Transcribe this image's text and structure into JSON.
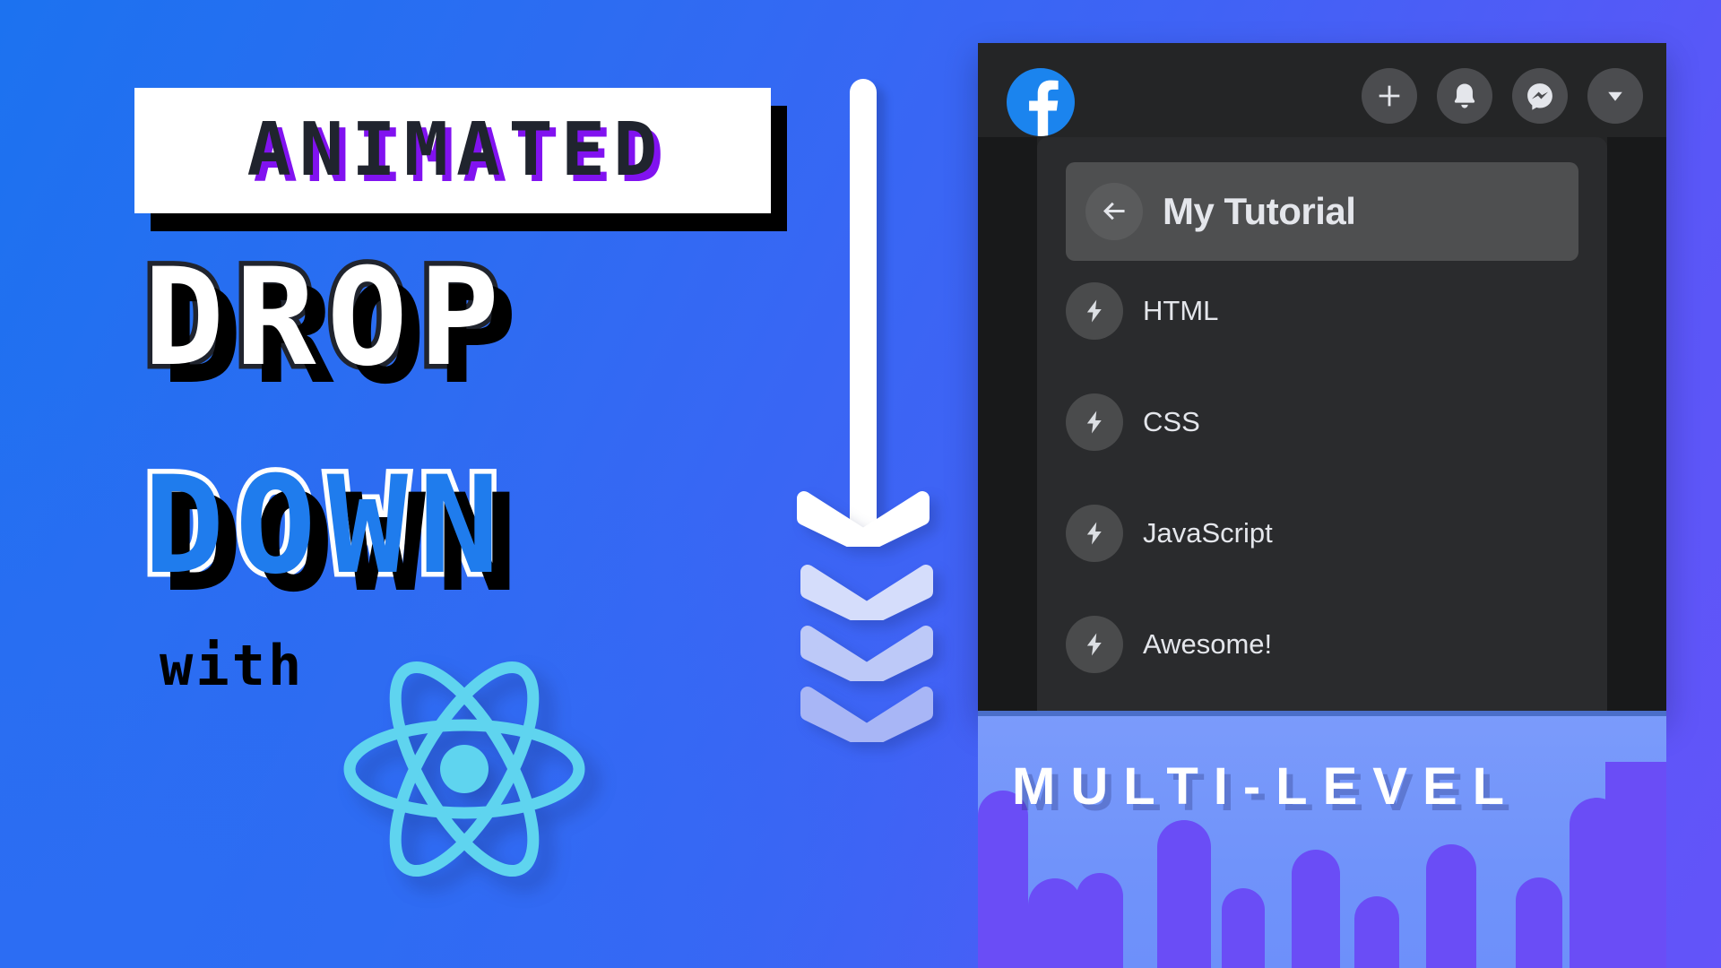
{
  "background": {
    "gradient_from": "#1c72f0",
    "gradient_to": "#6354f9"
  },
  "title_block": {
    "line1": "ANIMATED",
    "line2": "DROP",
    "line3": "DOWN",
    "line4": "with",
    "logo_name": "react-logo",
    "colors": {
      "animated_text": "#20242e",
      "animated_shadow": "#8112f0",
      "drop_fill": "#ffffff",
      "drop_outline": "#20242e",
      "down_fill": "#1f7ced",
      "down_outline": "#ffffff",
      "react_cyan": "#5fd4ef"
    }
  },
  "arrow": {
    "name": "downward-arrow",
    "chevron_count": 3,
    "color": "#ffffff"
  },
  "facebook_panel": {
    "logo": "facebook-logo",
    "actions": [
      {
        "name": "plus-icon",
        "label": "Create"
      },
      {
        "name": "bell-icon",
        "label": "Notifications"
      },
      {
        "name": "messenger-icon",
        "label": "Messenger"
      },
      {
        "name": "chevron-down-icon",
        "label": "Account"
      }
    ],
    "dropdown": {
      "back_icon": "arrow-left-icon",
      "header_title": "My Tutorial",
      "items": [
        {
          "icon": "bolt-icon",
          "label": "HTML"
        },
        {
          "icon": "bolt-icon",
          "label": "CSS"
        },
        {
          "icon": "bolt-icon",
          "label": "JavaScript"
        },
        {
          "icon": "bolt-icon",
          "label": "Awesome!"
        }
      ]
    }
  },
  "banner": {
    "drip_caption": "MULTI-LEVEL",
    "drip_color": "#6a4df6",
    "panel_color": "#7b9bfb"
  }
}
